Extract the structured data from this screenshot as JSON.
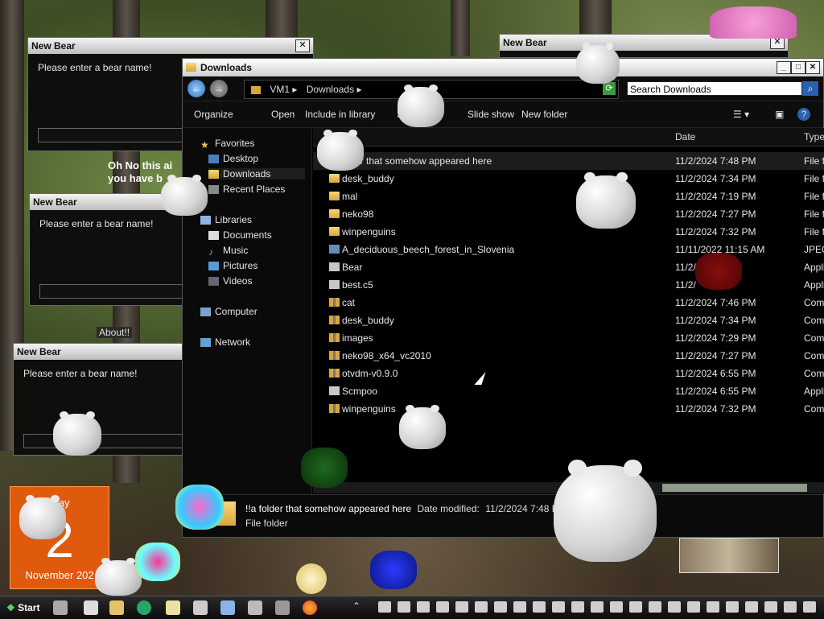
{
  "bear_dialogs": [
    {
      "title": "New Bear",
      "prompt": "Please enter a bear name!"
    },
    {
      "title": "New Bear",
      "prompt": "Please enter a bear name!"
    },
    {
      "title": "New Bear",
      "prompt": "Please enter a bear name!"
    },
    {
      "title": "New Bear"
    }
  ],
  "overlay_text": [
    "Oh No this ai",
    "you have b"
  ],
  "about_label": "About!!",
  "explorer": {
    "title": "Downloads",
    "breadcrumb": [
      "VM1",
      "Downloads"
    ],
    "search_placeholder": "Search Downloads",
    "toolbar": [
      "Organize",
      "Open",
      "Include in library",
      "S",
      "Slide show",
      "New folder"
    ],
    "nav": {
      "favorites": "Favorites",
      "desktop": "Desktop",
      "downloads": "Downloads",
      "recent": "Recent Places",
      "libraries": "Libraries",
      "documents": "Documents",
      "music": "Music",
      "pictures": "Pictures",
      "videos": "Videos",
      "computer": "Computer",
      "network": "Network"
    },
    "columns": {
      "date": "Date",
      "type": "Type"
    },
    "files": [
      {
        "name": "older that somehow appeared here",
        "date": "11/2/2024 7:48 PM",
        "type": "File f",
        "icon": "folder"
      },
      {
        "name": "desk_buddy",
        "date": "11/2/2024 7:34 PM",
        "type": "File f",
        "icon": "folder"
      },
      {
        "name": "mal",
        "date": "11/2/2024 7:19 PM",
        "type": "File f",
        "icon": "folder"
      },
      {
        "name": "neko98",
        "date": "11/2/2024 7:27 PM",
        "type": "File f",
        "icon": "folder"
      },
      {
        "name": "winpenguins",
        "date": "11/2/2024 7:32 PM",
        "type": "File f",
        "icon": "folder"
      },
      {
        "name": "A_deciduous_beech_forest_in_Slovenia",
        "date": "11/11/2022 11:15 AM",
        "type": "JPEG",
        "icon": "image"
      },
      {
        "name": "Bear",
        "date": "11/2/",
        "type": "Appli",
        "icon": "app"
      },
      {
        "name": "best.c5",
        "date": "11/2/",
        "type": "Appli",
        "icon": "app"
      },
      {
        "name": "cat",
        "date": "11/2/2024 7:46 PM",
        "type": "Comp",
        "icon": "zip"
      },
      {
        "name": "desk_buddy",
        "date": "11/2/2024 7:34 PM",
        "type": "Comp",
        "icon": "zip"
      },
      {
        "name": "images",
        "date": "11/2/2024 7:29 PM",
        "type": "Comp",
        "icon": "zip"
      },
      {
        "name": "neko98_x64_vc2010",
        "date": "11/2/2024 7:27 PM",
        "type": "Comp",
        "icon": "zip"
      },
      {
        "name": "otvdm-v0.9.0",
        "date": "11/2/2024 6:55 PM",
        "type": "Comp",
        "icon": "zip"
      },
      {
        "name": "Scmpoo",
        "date": "11/2/2024 6:55 PM",
        "type": "Appli",
        "icon": "app"
      },
      {
        "name": "winpenguins",
        "date": "11/2/2024 7:32 PM",
        "type": "Comp",
        "icon": "zip"
      }
    ],
    "details": {
      "name": "!!a folder that somehow appeared here",
      "modified_label": "Date modified:",
      "modified_value": "11/2/2024 7:48 PI",
      "kind": "File folder"
    }
  },
  "calendar": {
    "day": "rday",
    "number": "2",
    "month": "November 202"
  },
  "taskbar": {
    "start": "Start"
  },
  "colors": {
    "accent": "#e05a0e",
    "selection": "#1c1c1c",
    "link_blue": "#2b5fb0"
  }
}
